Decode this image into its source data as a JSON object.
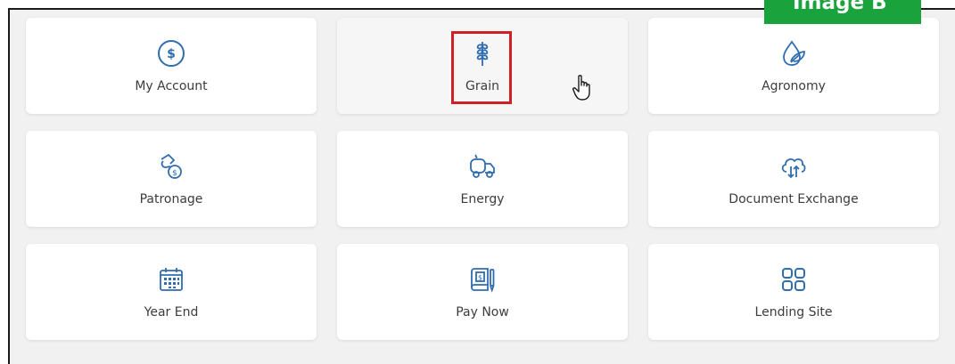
{
  "badge": {
    "text": "Image B",
    "color": "#1aa23c"
  },
  "highlight_color": "#cf2027",
  "icon_color": "#2f6db0",
  "tiles": [
    {
      "label": "My Account",
      "icon": "dollar-circle-icon"
    },
    {
      "label": "Grain",
      "icon": "wheat-icon"
    },
    {
      "label": "Agronomy",
      "icon": "leaf-drop-icon"
    },
    {
      "label": "Patronage",
      "icon": "money-bag-hand-icon"
    },
    {
      "label": "Energy",
      "icon": "fuel-truck-icon"
    },
    {
      "label": "Document Exchange",
      "icon": "cloud-sync-icon"
    },
    {
      "label": "Year End",
      "icon": "calendar-icon"
    },
    {
      "label": "Pay Now",
      "icon": "bill-pen-icon"
    },
    {
      "label": "Lending Site",
      "icon": "grid-apps-icon"
    }
  ],
  "cursor": "hand-pointer-icon"
}
